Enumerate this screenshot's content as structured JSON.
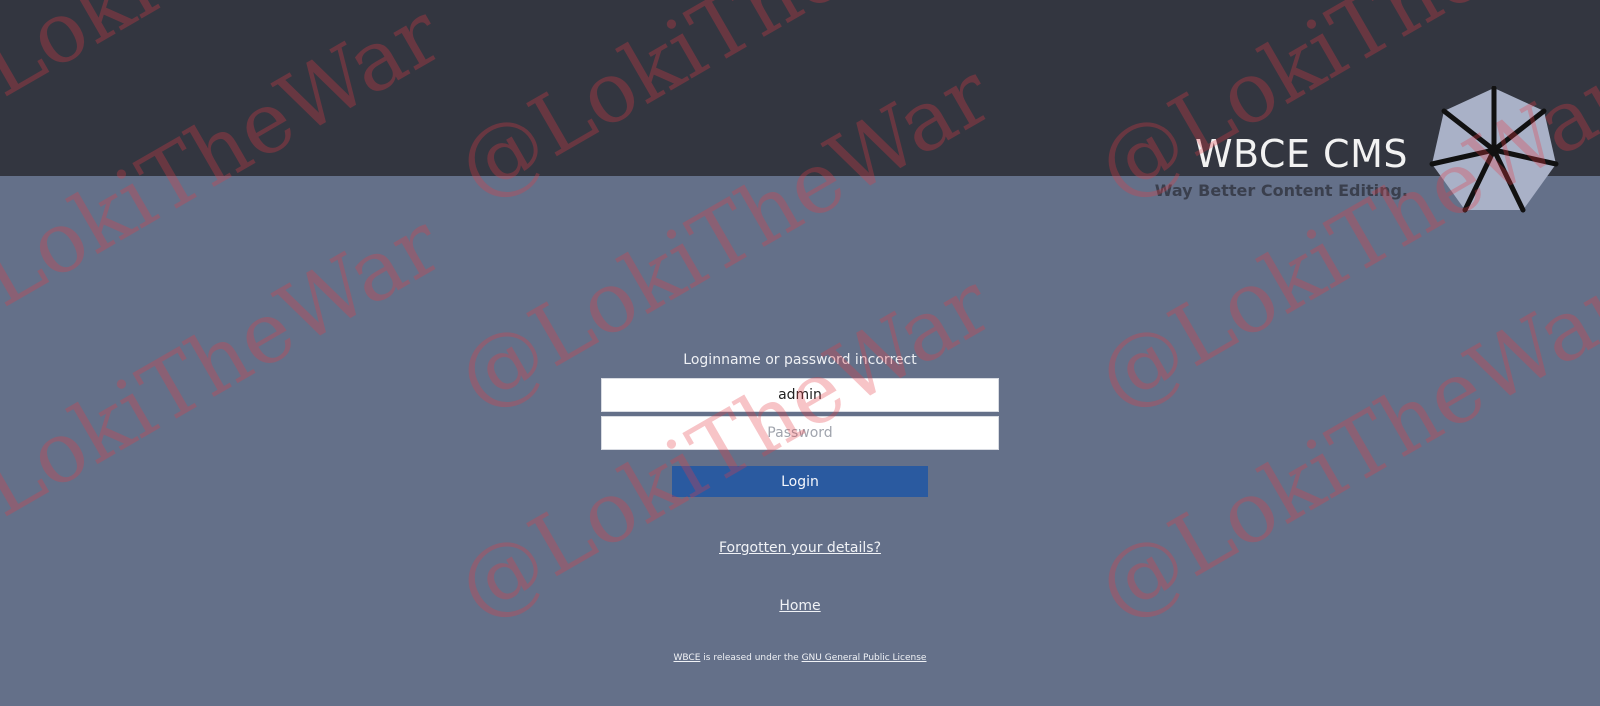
{
  "brand": {
    "name": "WBCE CMS",
    "tagline": "Way Better Content Editing.",
    "logo_icon": "wbce-star-heptagon-logo"
  },
  "login": {
    "error_message": "Loginname or password incorrect",
    "username_value": "admin",
    "password_placeholder": "Password",
    "login_button": "Login",
    "forgot_link": "Forgotten your details?",
    "home_link": "Home"
  },
  "footer": {
    "wbce_link": "WBCE",
    "middle_text": " is released under the ",
    "license_link": "GNU General Public License"
  },
  "watermark": {
    "text": "@LokiTheWar"
  },
  "colors": {
    "header_bg": "#333640",
    "page_bg": "#647089",
    "button_bg": "#2a5aa0",
    "logo_fill": "#a9b1c7"
  }
}
